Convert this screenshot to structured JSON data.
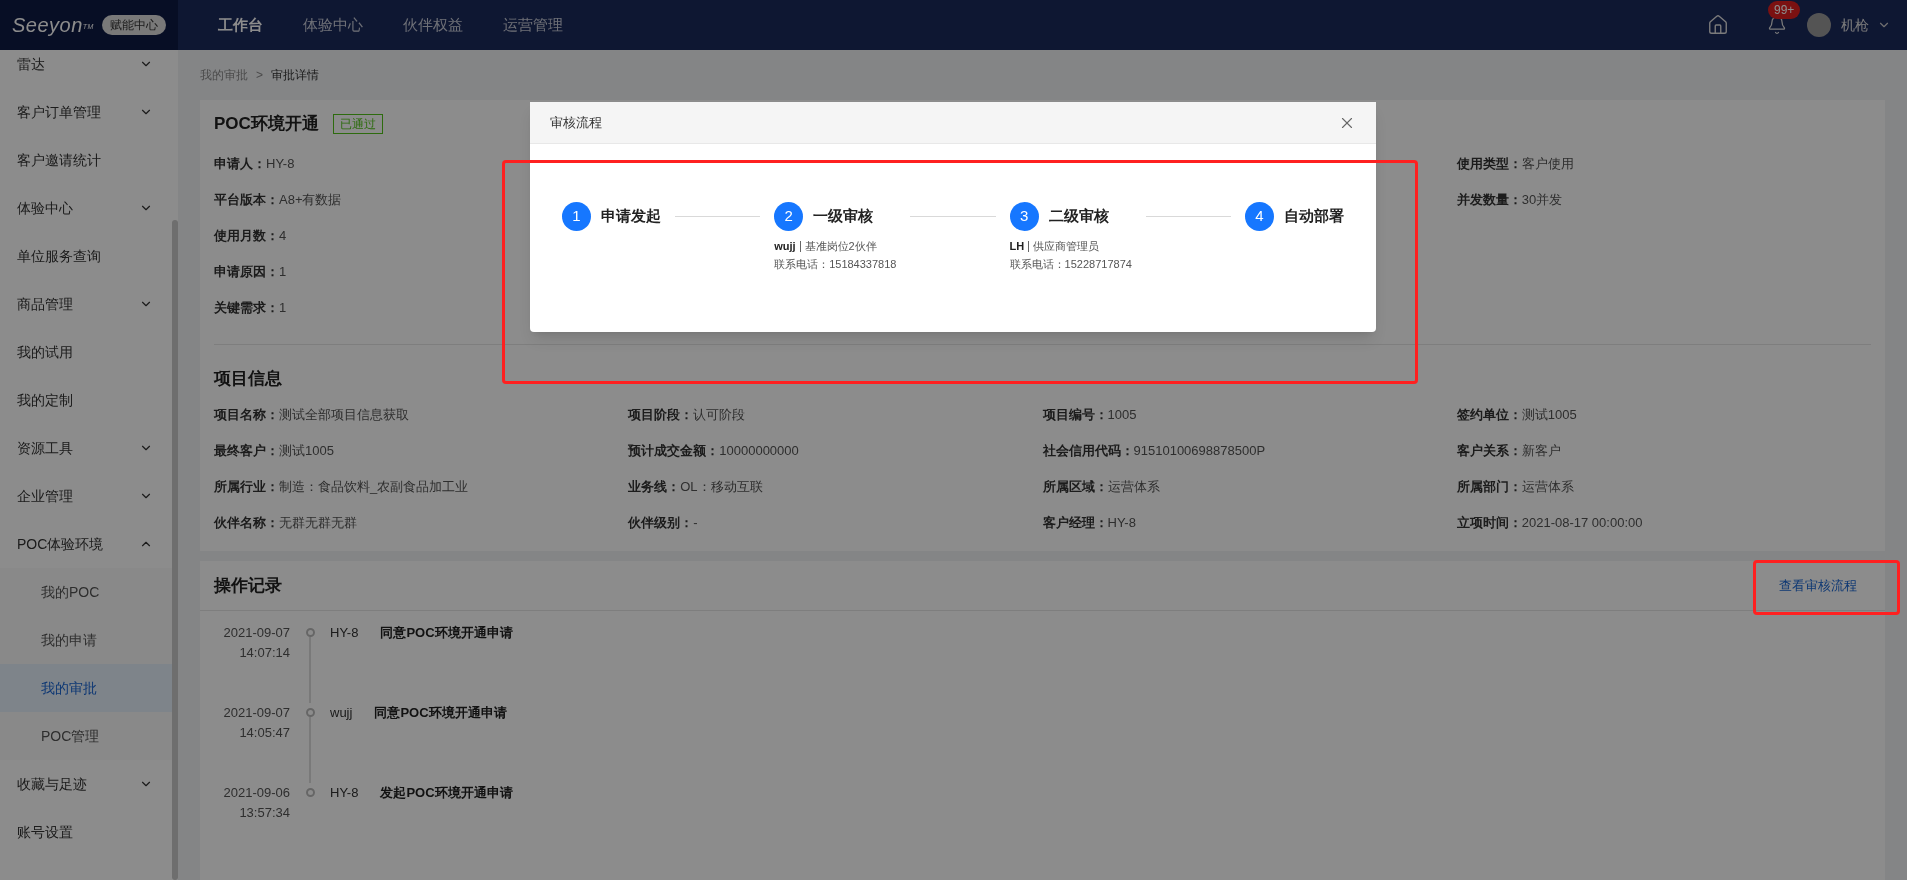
{
  "header": {
    "logo": "Seeyon",
    "logo_mark": "TM",
    "logo_badge": "赋能中心",
    "nav": [
      {
        "label": "工作台",
        "selected": true
      },
      {
        "label": "体验中心",
        "selected": false
      },
      {
        "label": "伙伴权益",
        "selected": false
      },
      {
        "label": "运营管理",
        "selected": false
      }
    ],
    "notification_badge": "99+",
    "user_name": "机枪"
  },
  "sidebar": {
    "items": [
      {
        "label": "雷达",
        "kind": "group",
        "expanded": false
      },
      {
        "label": "客户订单管理",
        "kind": "group",
        "expanded": false
      },
      {
        "label": "客户邀请统计",
        "kind": "link"
      },
      {
        "label": "体验中心",
        "kind": "group",
        "expanded": false
      },
      {
        "label": "单位服务查询",
        "kind": "link"
      },
      {
        "label": "商品管理",
        "kind": "group",
        "expanded": false
      },
      {
        "label": "我的试用",
        "kind": "link"
      },
      {
        "label": "我的定制",
        "kind": "link"
      },
      {
        "label": "资源工具",
        "kind": "group",
        "expanded": false
      },
      {
        "label": "企业管理",
        "kind": "group",
        "expanded": false
      },
      {
        "label": "POC体验环境",
        "kind": "group",
        "expanded": true,
        "children": [
          {
            "label": "我的POC",
            "selected": false
          },
          {
            "label": "我的申请",
            "selected": false
          },
          {
            "label": "我的审批",
            "selected": true
          },
          {
            "label": "POC管理",
            "selected": false
          }
        ]
      },
      {
        "label": "收藏与足迹",
        "kind": "group",
        "expanded": false
      },
      {
        "label": "账号设置",
        "kind": "link"
      }
    ]
  },
  "breadcrumb": {
    "parent": "我的审批",
    "separator": ">",
    "current": "审批详情"
  },
  "application": {
    "title": "POC环境开通",
    "status": "已通过",
    "left_fields": [
      {
        "label": "申请人：",
        "value": "HY-8"
      },
      {
        "label": "平台版本：",
        "value": "A8+有数据"
      },
      {
        "label": "使用月数：",
        "value": "4"
      },
      {
        "label": "申请原因：",
        "value": "1"
      },
      {
        "label": "关键需求：",
        "value": "1"
      }
    ],
    "right_fields": [
      {
        "label": "使用类型：",
        "value": "客户使用"
      },
      {
        "label": "并发数量：",
        "value": "30并发"
      }
    ]
  },
  "project_info": {
    "title": "项目信息",
    "fields": [
      {
        "label": "项目名称：",
        "value": "测试全部项目信息获取"
      },
      {
        "label": "项目阶段：",
        "value": "认可阶段"
      },
      {
        "label": "项目编号：",
        "value": "1005"
      },
      {
        "label": "签约单位：",
        "value": "测试1005"
      },
      {
        "label": "最终客户：",
        "value": "测试1005"
      },
      {
        "label": "预计成交金额：",
        "value": "10000000000"
      },
      {
        "label": "社会信用代码：",
        "value": "91510100698878500P"
      },
      {
        "label": "客户关系：",
        "value": "新客户"
      },
      {
        "label": "所属行业：",
        "value": "制造：食品饮料_农副食品加工业"
      },
      {
        "label": "业务线：",
        "value": "OL：移动互联"
      },
      {
        "label": "所属区域：",
        "value": "运营体系"
      },
      {
        "label": "所属部门：",
        "value": "运营体系"
      },
      {
        "label": "伙伴名称：",
        "value": "无群无群无群"
      },
      {
        "label": "伙伴级别：",
        "value": "-"
      },
      {
        "label": "客户经理：",
        "value": "HY-8"
      },
      {
        "label": "立项时间：",
        "value": "2021-08-17 00:00:00"
      }
    ]
  },
  "operation_log": {
    "title": "操作记录",
    "link": "查看审核流程",
    "entries": [
      {
        "date": "2021-09-07",
        "time": "14:07:14",
        "user": "HY-8",
        "action": "同意POC环境开通申请"
      },
      {
        "date": "2021-09-07",
        "time": "14:05:47",
        "user": "wujj",
        "action": "同意POC环境开通申请"
      },
      {
        "date": "2021-09-06",
        "time": "13:57:34",
        "user": "HY-8",
        "action": "发起POC环境开通申请"
      }
    ]
  },
  "dialog": {
    "title": "审核流程",
    "steps": [
      {
        "number": "1",
        "label": "申请发起"
      },
      {
        "number": "2",
        "label": "一级审核",
        "person": "wujj",
        "role": "基准岗位2伙伴",
        "phone": "联系电话：15184337818"
      },
      {
        "number": "3",
        "label": "二级审核",
        "person": "LH",
        "role": "供应商管理员",
        "phone": "联系电话：15228717874"
      },
      {
        "number": "4",
        "label": "自动部署"
      }
    ]
  }
}
